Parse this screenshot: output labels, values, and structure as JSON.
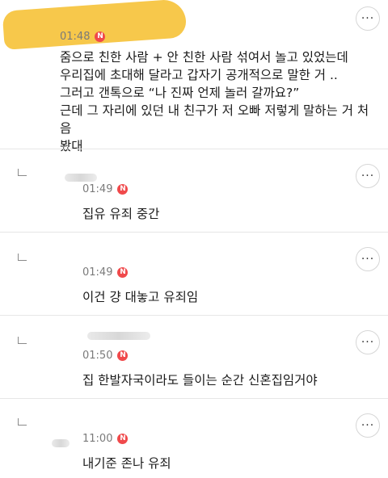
{
  "post": {
    "time": "01:48",
    "badge": "N",
    "text": "줌으로 친한 사람 + 안 친한 사람 섞여서 놀고 있었는데\n우리집에 초대해 달라고 갑자기 공개적으로 말한 거 ..\n그러고 갠톡으로 “나 진짜 언제 놀러 갈까요?”\n근데 그 자리에 있던 내 친구가 저 오빠 저렇게 말하는 거 처음\n봤대",
    "more": "···"
  },
  "replies": [
    {
      "time": "01:49",
      "badge": "N",
      "text": "집유 유죄 중간",
      "more": "···"
    },
    {
      "time": "01:49",
      "badge": "N",
      "text": "이건 걍 대놓고 유죄임",
      "more": "···"
    },
    {
      "time": "01:50",
      "badge": "N",
      "text": "집 한발자국이라도 들이는 순간 신혼집임거야",
      "more": "···"
    },
    {
      "time": "11:00",
      "badge": "N",
      "text": "내기준 존나 유죄",
      "more": "···"
    }
  ],
  "colors": {
    "badge": "#f0494b",
    "redaction": "#f7c84b"
  }
}
